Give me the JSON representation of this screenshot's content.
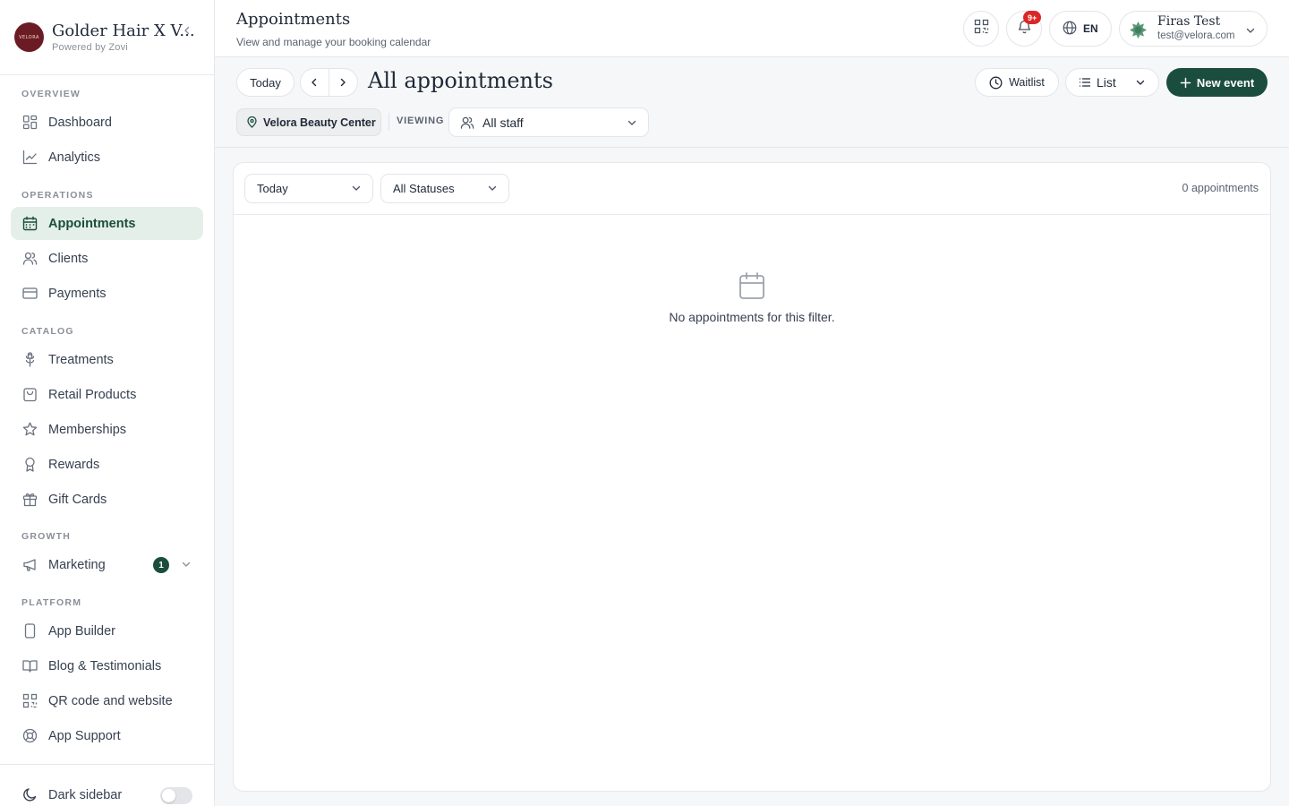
{
  "brand": {
    "name": "Golder Hair X V...",
    "sub": "Powered by Zovi",
    "logo_text": "VELORA"
  },
  "sidebar": {
    "sections": {
      "overview": "OVERVIEW",
      "operations": "OPERATIONS",
      "catalog": "CATALOG",
      "growth": "GROWTH",
      "platform": "PLATFORM"
    },
    "items": {
      "dashboard": "Dashboard",
      "analytics": "Analytics",
      "appointments": "Appointments",
      "clients": "Clients",
      "payments": "Payments",
      "treatments": "Treatments",
      "retail_products": "Retail Products",
      "memberships": "Memberships",
      "rewards": "Rewards",
      "gift_cards": "Gift Cards",
      "marketing": "Marketing",
      "app_builder": "App Builder",
      "blog": "Blog & Testimonials",
      "qr_code": "QR code and website",
      "app_support": "App Support"
    },
    "marketing_badge": "1",
    "dark_sidebar": "Dark sidebar",
    "dark_sidebar_on": false,
    "active_item": "appointments"
  },
  "header": {
    "title": "Appointments",
    "subtitle": "View and manage your booking calendar",
    "notification_badge": "9+",
    "language": "EN",
    "user": {
      "name": "Firas Test",
      "email": "test@velora.com"
    }
  },
  "toolbar": {
    "today_label": "Today",
    "view_title": "All appointments",
    "waitlist_label": "Waitlist",
    "view_mode": "List",
    "new_event_label": "New event",
    "location": "Velora Beauty Center",
    "viewing_label": "VIEWING",
    "staff_select": "All staff"
  },
  "filters": {
    "date_filter": "Today",
    "status_filter": "All Statuses",
    "count": "0 appointments"
  },
  "empty_state": {
    "message": "No appointments for this filter."
  },
  "colors": {
    "accent": "#1b4d3e",
    "active_bg": "#e5efe9",
    "badge_red": "#dc2626",
    "logo_bg": "#6b1b24"
  }
}
